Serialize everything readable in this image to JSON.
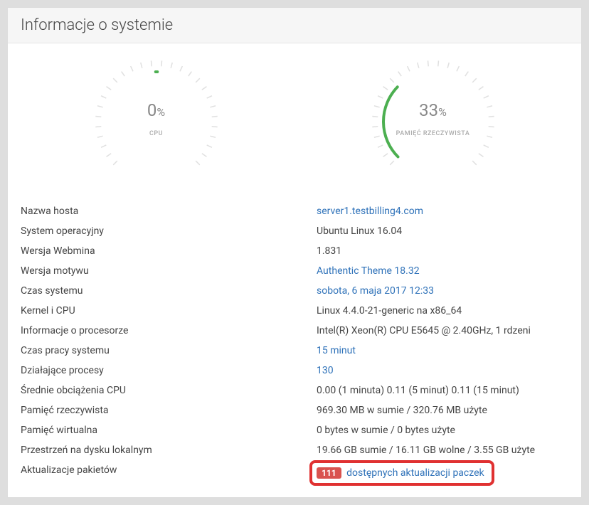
{
  "header": {
    "title": "Informacje o systemie"
  },
  "gauges": {
    "cpu": {
      "value": "0",
      "unit": "%",
      "label": "CPU",
      "percent": 0
    },
    "mem": {
      "value": "33",
      "unit": "%",
      "label": "PAMIĘĆ RZECZYWISTA",
      "percent": 33
    }
  },
  "rows": [
    {
      "label": "Nazwa hosta",
      "value": "server1.testbilling4.com",
      "link": true
    },
    {
      "label": "System operacyjny",
      "value": "Ubuntu Linux 16.04",
      "link": false
    },
    {
      "label": "Wersja Webmina",
      "value": "1.831",
      "link": false
    },
    {
      "label": "Wersja motywu",
      "value": "Authentic Theme 18.32",
      "link": true
    },
    {
      "label": "Czas systemu",
      "value": "sobota, 6 maja 2017 12:33",
      "link": true
    },
    {
      "label": "Kernel i CPU",
      "value": "Linux 4.4.0-21-generic na x86_64",
      "link": false
    },
    {
      "label": "Informacje o procesorze",
      "value": "Intel(R) Xeon(R) CPU E5645 @ 2.40GHz, 1 rdzeni",
      "link": false
    },
    {
      "label": "Czas pracy systemu",
      "value": "15 minut",
      "link": true
    },
    {
      "label": "Działające procesy",
      "value": "130",
      "link": true
    },
    {
      "label": "Średnie obciążenia CPU",
      "value": "0.00 (1 minuta) 0.11 (5 minut) 0.11 (15 minut)",
      "link": false
    },
    {
      "label": "Pamięć rzeczywista",
      "value": "969.30 MB w sumie / 320.76 MB użyte",
      "link": false
    },
    {
      "label": "Pamięć wirtualna",
      "value": "0 bytes w sumie / 0 bytes użyte",
      "link": false
    },
    {
      "label": "Przestrzeń na dysku lokalnym",
      "value": "19.66 GB sumie / 16.11 GB wolne / 3.55 GB użyte",
      "link": false
    }
  ],
  "updates": {
    "label": "Aktualizacje pakietów",
    "count": "111",
    "text": "dostępnych aktualizacji paczek"
  }
}
